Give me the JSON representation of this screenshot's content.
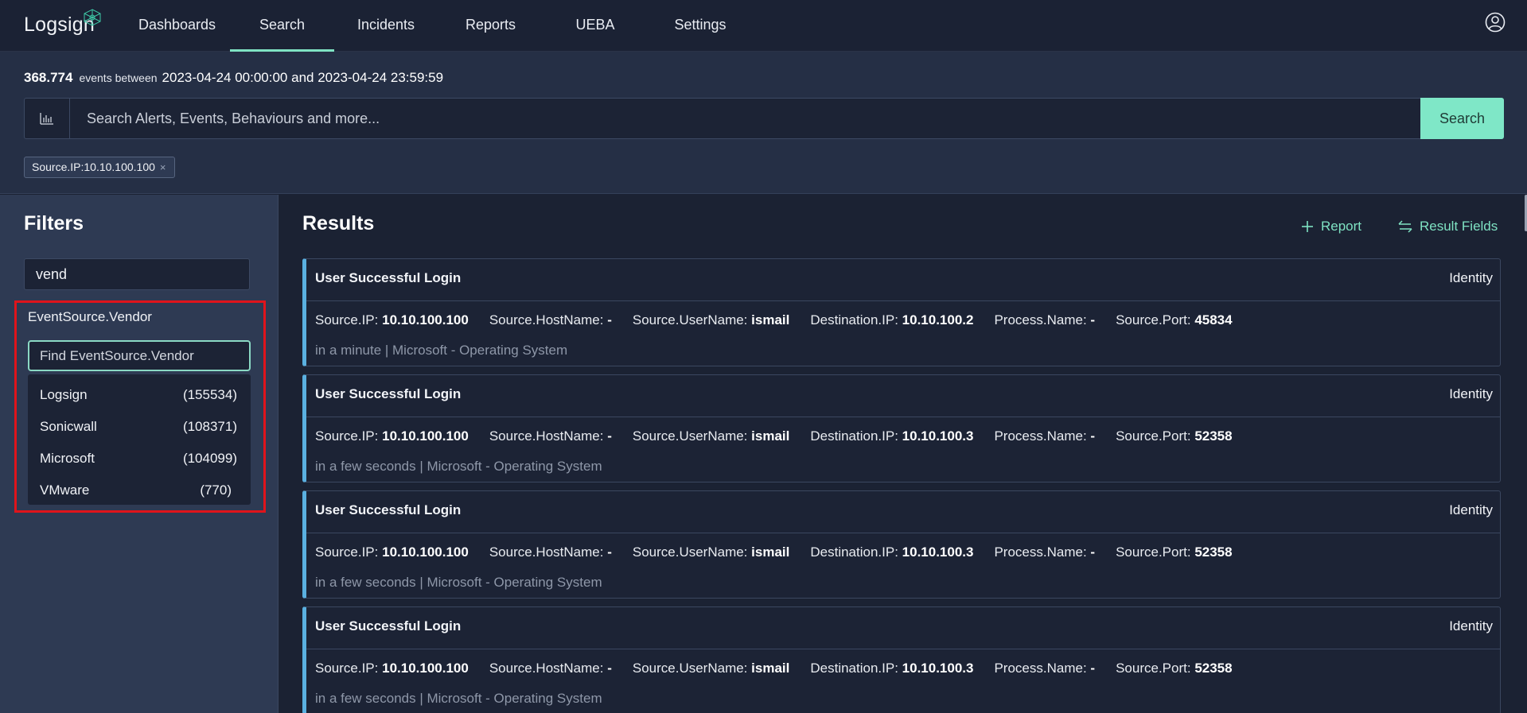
{
  "brand": {
    "logo_text": "Logsign"
  },
  "nav": {
    "items": [
      {
        "label": "Dashboards"
      },
      {
        "label": "Search"
      },
      {
        "label": "Incidents"
      },
      {
        "label": "Reports"
      },
      {
        "label": "UEBA"
      },
      {
        "label": "Settings"
      }
    ],
    "active": "Search"
  },
  "search": {
    "event_count": "368.774",
    "events_between_label": "events between",
    "range_text": "2023-04-24 00:00:00 and 2023-04-24 23:59:59",
    "placeholder": "Search Alerts, Events, Behaviours and more...",
    "button_label": "Search",
    "chip_label": "Source.IP:10.10.100.100",
    "chip_close": "×"
  },
  "filters": {
    "title": "Filters",
    "search_value": "vend",
    "group_title": "EventSource.Vendor",
    "find_placeholder": "Find EventSource.Vendor",
    "vendors": [
      {
        "name": "Logsign",
        "count": "(155534)"
      },
      {
        "name": "Sonicwall",
        "count": "(108371)"
      },
      {
        "name": "Microsoft",
        "count": "(104099)"
      },
      {
        "name": "VMware",
        "count": "(770)"
      }
    ]
  },
  "results": {
    "title": "Results",
    "report_label": "Report",
    "result_fields_label": "Result Fields",
    "items": [
      {
        "title": "User Successful Login",
        "category": "Identity",
        "fields": [
          {
            "key": "Source.IP:",
            "value": "10.10.100.100"
          },
          {
            "key": "Source.HostName:",
            "value": "-"
          },
          {
            "key": "Source.UserName:",
            "value": "ismail"
          },
          {
            "key": "Destination.IP:",
            "value": "10.10.100.2"
          },
          {
            "key": "Process.Name:",
            "value": "-"
          },
          {
            "key": "Source.Port:",
            "value": "45834"
          }
        ],
        "meta": "in a minute | Microsoft - Operating System"
      },
      {
        "title": "User Successful Login",
        "category": "Identity",
        "fields": [
          {
            "key": "Source.IP:",
            "value": "10.10.100.100"
          },
          {
            "key": "Source.HostName:",
            "value": "-"
          },
          {
            "key": "Source.UserName:",
            "value": "ismail"
          },
          {
            "key": "Destination.IP:",
            "value": "10.10.100.3"
          },
          {
            "key": "Process.Name:",
            "value": "-"
          },
          {
            "key": "Source.Port:",
            "value": "52358"
          }
        ],
        "meta": "in a few seconds | Microsoft - Operating System"
      },
      {
        "title": "User Successful Login",
        "category": "Identity",
        "fields": [
          {
            "key": "Source.IP:",
            "value": "10.10.100.100"
          },
          {
            "key": "Source.HostName:",
            "value": "-"
          },
          {
            "key": "Source.UserName:",
            "value": "ismail"
          },
          {
            "key": "Destination.IP:",
            "value": "10.10.100.3"
          },
          {
            "key": "Process.Name:",
            "value": "-"
          },
          {
            "key": "Source.Port:",
            "value": "52358"
          }
        ],
        "meta": "in a few seconds | Microsoft - Operating System"
      },
      {
        "title": "User Successful Login",
        "category": "Identity",
        "fields": [
          {
            "key": "Source.IP:",
            "value": "10.10.100.100"
          },
          {
            "key": "Source.HostName:",
            "value": "-"
          },
          {
            "key": "Source.UserName:",
            "value": "ismail"
          },
          {
            "key": "Destination.IP:",
            "value": "10.10.100.3"
          },
          {
            "key": "Process.Name:",
            "value": "-"
          },
          {
            "key": "Source.Port:",
            "value": "52358"
          }
        ],
        "meta": "in a few seconds | Microsoft - Operating System"
      }
    ]
  },
  "colors": {
    "accent": "#7fe7c7",
    "card_border_left": "#5ab0e0",
    "highlight": "#e0141b"
  }
}
